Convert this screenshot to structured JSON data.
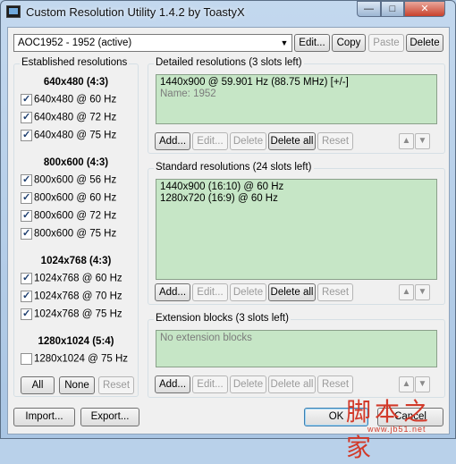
{
  "window": {
    "title": "Custom Resolution Utility 1.4.2 by ToastyX"
  },
  "caption_buttons": {
    "minimize": "—",
    "maximize": "□",
    "close": "✕"
  },
  "monitor": {
    "selected": "AOC1952 - 1952 (active)",
    "arrow": "▼"
  },
  "top_buttons": {
    "edit": "Edit...",
    "copy": "Copy",
    "paste": "Paste",
    "delete": "Delete"
  },
  "established": {
    "title": "Established resolutions",
    "groups": [
      {
        "heading": "640x480 (4:3)",
        "items": [
          {
            "label": "640x480 @ 60 Hz",
            "checked": true
          },
          {
            "label": "640x480 @ 72 Hz",
            "checked": true
          },
          {
            "label": "640x480 @ 75 Hz",
            "checked": true
          }
        ]
      },
      {
        "heading": "800x600 (4:3)",
        "items": [
          {
            "label": "800x600 @ 56 Hz",
            "checked": true
          },
          {
            "label": "800x600 @ 60 Hz",
            "checked": true
          },
          {
            "label": "800x600 @ 72 Hz",
            "checked": true
          },
          {
            "label": "800x600 @ 75 Hz",
            "checked": true
          }
        ]
      },
      {
        "heading": "1024x768 (4:3)",
        "items": [
          {
            "label": "1024x768 @ 60 Hz",
            "checked": true
          },
          {
            "label": "1024x768 @ 70 Hz",
            "checked": true
          },
          {
            "label": "1024x768 @ 75 Hz",
            "checked": true
          }
        ]
      },
      {
        "heading": "1280x1024 (5:4)",
        "items": [
          {
            "label": "1280x1024 @ 75 Hz",
            "checked": false
          }
        ]
      }
    ],
    "all": "All",
    "none": "None",
    "reset": "Reset"
  },
  "detailed": {
    "title": "Detailed resolutions (3 slots left)",
    "line1": "1440x900 @ 59.901 Hz (88.75 MHz) [+/-]",
    "line2": "Name: 1952",
    "add": "Add...",
    "edit": "Edit...",
    "delete": "Delete",
    "delete_all": "Delete all",
    "reset": "Reset"
  },
  "standard": {
    "title": "Standard resolutions (24 slots left)",
    "line1": "1440x900 (16:10) @ 60 Hz",
    "line2": "1280x720 (16:9) @ 60 Hz",
    "add": "Add...",
    "edit": "Edit...",
    "delete": "Delete",
    "delete_all": "Delete all",
    "reset": "Reset"
  },
  "extension": {
    "title": "Extension blocks (3 slots left)",
    "empty": "No extension blocks",
    "add": "Add...",
    "edit": "Edit...",
    "delete": "Delete",
    "delete_all": "Delete all",
    "reset": "Reset"
  },
  "arrows": {
    "up": "▲",
    "down": "▼"
  },
  "bottom": {
    "import": "Import...",
    "export": "Export...",
    "ok": "OK",
    "cancel": "Cancel"
  },
  "watermark": {
    "text": "脚本之家",
    "url": "www.jb51.net"
  }
}
